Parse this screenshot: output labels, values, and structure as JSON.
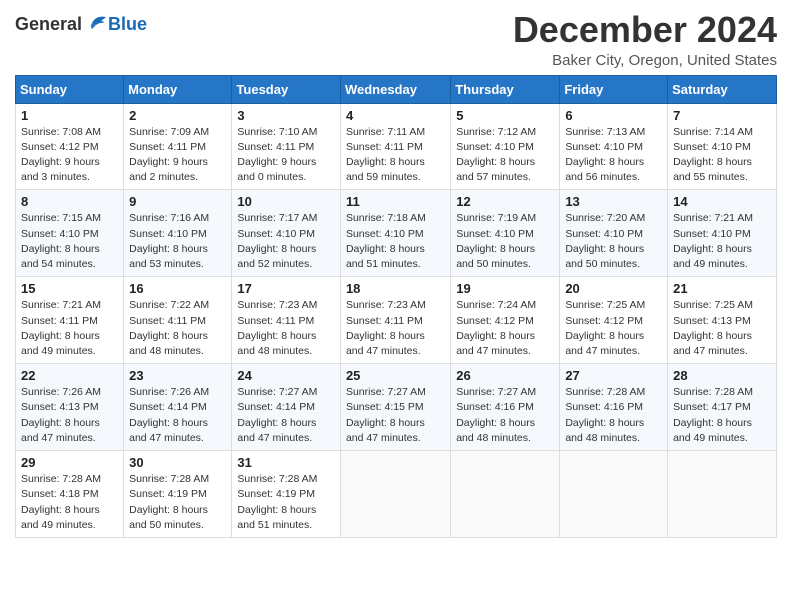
{
  "logo": {
    "general": "General",
    "blue": "Blue"
  },
  "title": "December 2024",
  "subtitle": "Baker City, Oregon, United States",
  "headers": [
    "Sunday",
    "Monday",
    "Tuesday",
    "Wednesday",
    "Thursday",
    "Friday",
    "Saturday"
  ],
  "weeks": [
    [
      {
        "day": "1",
        "info": "Sunrise: 7:08 AM\nSunset: 4:12 PM\nDaylight: 9 hours\nand 3 minutes."
      },
      {
        "day": "2",
        "info": "Sunrise: 7:09 AM\nSunset: 4:11 PM\nDaylight: 9 hours\nand 2 minutes."
      },
      {
        "day": "3",
        "info": "Sunrise: 7:10 AM\nSunset: 4:11 PM\nDaylight: 9 hours\nand 0 minutes."
      },
      {
        "day": "4",
        "info": "Sunrise: 7:11 AM\nSunset: 4:11 PM\nDaylight: 8 hours\nand 59 minutes."
      },
      {
        "day": "5",
        "info": "Sunrise: 7:12 AM\nSunset: 4:10 PM\nDaylight: 8 hours\nand 57 minutes."
      },
      {
        "day": "6",
        "info": "Sunrise: 7:13 AM\nSunset: 4:10 PM\nDaylight: 8 hours\nand 56 minutes."
      },
      {
        "day": "7",
        "info": "Sunrise: 7:14 AM\nSunset: 4:10 PM\nDaylight: 8 hours\nand 55 minutes."
      }
    ],
    [
      {
        "day": "8",
        "info": "Sunrise: 7:15 AM\nSunset: 4:10 PM\nDaylight: 8 hours\nand 54 minutes."
      },
      {
        "day": "9",
        "info": "Sunrise: 7:16 AM\nSunset: 4:10 PM\nDaylight: 8 hours\nand 53 minutes."
      },
      {
        "day": "10",
        "info": "Sunrise: 7:17 AM\nSunset: 4:10 PM\nDaylight: 8 hours\nand 52 minutes."
      },
      {
        "day": "11",
        "info": "Sunrise: 7:18 AM\nSunset: 4:10 PM\nDaylight: 8 hours\nand 51 minutes."
      },
      {
        "day": "12",
        "info": "Sunrise: 7:19 AM\nSunset: 4:10 PM\nDaylight: 8 hours\nand 50 minutes."
      },
      {
        "day": "13",
        "info": "Sunrise: 7:20 AM\nSunset: 4:10 PM\nDaylight: 8 hours\nand 50 minutes."
      },
      {
        "day": "14",
        "info": "Sunrise: 7:21 AM\nSunset: 4:10 PM\nDaylight: 8 hours\nand 49 minutes."
      }
    ],
    [
      {
        "day": "15",
        "info": "Sunrise: 7:21 AM\nSunset: 4:11 PM\nDaylight: 8 hours\nand 49 minutes."
      },
      {
        "day": "16",
        "info": "Sunrise: 7:22 AM\nSunset: 4:11 PM\nDaylight: 8 hours\nand 48 minutes."
      },
      {
        "day": "17",
        "info": "Sunrise: 7:23 AM\nSunset: 4:11 PM\nDaylight: 8 hours\nand 48 minutes."
      },
      {
        "day": "18",
        "info": "Sunrise: 7:23 AM\nSunset: 4:11 PM\nDaylight: 8 hours\nand 47 minutes."
      },
      {
        "day": "19",
        "info": "Sunrise: 7:24 AM\nSunset: 4:12 PM\nDaylight: 8 hours\nand 47 minutes."
      },
      {
        "day": "20",
        "info": "Sunrise: 7:25 AM\nSunset: 4:12 PM\nDaylight: 8 hours\nand 47 minutes."
      },
      {
        "day": "21",
        "info": "Sunrise: 7:25 AM\nSunset: 4:13 PM\nDaylight: 8 hours\nand 47 minutes."
      }
    ],
    [
      {
        "day": "22",
        "info": "Sunrise: 7:26 AM\nSunset: 4:13 PM\nDaylight: 8 hours\nand 47 minutes."
      },
      {
        "day": "23",
        "info": "Sunrise: 7:26 AM\nSunset: 4:14 PM\nDaylight: 8 hours\nand 47 minutes."
      },
      {
        "day": "24",
        "info": "Sunrise: 7:27 AM\nSunset: 4:14 PM\nDaylight: 8 hours\nand 47 minutes."
      },
      {
        "day": "25",
        "info": "Sunrise: 7:27 AM\nSunset: 4:15 PM\nDaylight: 8 hours\nand 47 minutes."
      },
      {
        "day": "26",
        "info": "Sunrise: 7:27 AM\nSunset: 4:16 PM\nDaylight: 8 hours\nand 48 minutes."
      },
      {
        "day": "27",
        "info": "Sunrise: 7:28 AM\nSunset: 4:16 PM\nDaylight: 8 hours\nand 48 minutes."
      },
      {
        "day": "28",
        "info": "Sunrise: 7:28 AM\nSunset: 4:17 PM\nDaylight: 8 hours\nand 49 minutes."
      }
    ],
    [
      {
        "day": "29",
        "info": "Sunrise: 7:28 AM\nSunset: 4:18 PM\nDaylight: 8 hours\nand 49 minutes."
      },
      {
        "day": "30",
        "info": "Sunrise: 7:28 AM\nSunset: 4:19 PM\nDaylight: 8 hours\nand 50 minutes."
      },
      {
        "day": "31",
        "info": "Sunrise: 7:28 AM\nSunset: 4:19 PM\nDaylight: 8 hours\nand 51 minutes."
      },
      {
        "day": "",
        "info": ""
      },
      {
        "day": "",
        "info": ""
      },
      {
        "day": "",
        "info": ""
      },
      {
        "day": "",
        "info": ""
      }
    ]
  ]
}
